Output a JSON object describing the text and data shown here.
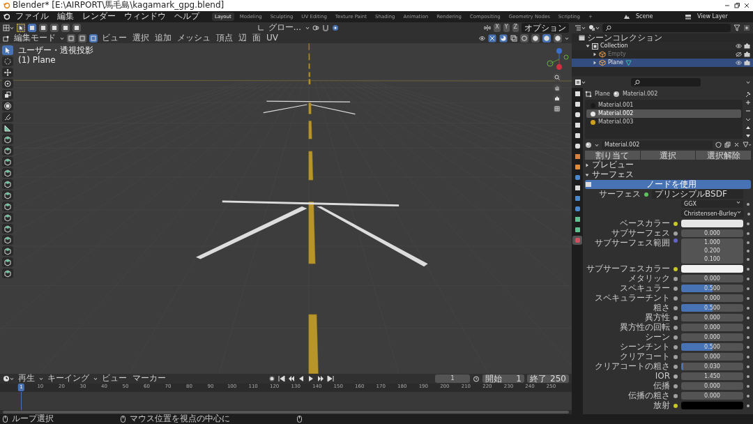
{
  "window": {
    "title": "Blender* [E:\\AIRPORT\\馬毛島\\kagamark_gpg.blend]"
  },
  "menu": [
    "ファイル",
    "編集",
    "レンダー",
    "ウィンドウ",
    "ヘルプ"
  ],
  "workspaces": [
    {
      "label": "Layout",
      "selected": true
    },
    {
      "label": "Modeling",
      "selected": false
    },
    {
      "label": "Sculpting",
      "selected": false
    },
    {
      "label": "UV Editing",
      "selected": false
    },
    {
      "label": "Texture Paint",
      "selected": false
    },
    {
      "label": "Shading",
      "selected": false
    },
    {
      "label": "Animation",
      "selected": false
    },
    {
      "label": "Rendering",
      "selected": false
    },
    {
      "label": "Compositing",
      "selected": false
    },
    {
      "label": "Geometry Nodes",
      "selected": false
    },
    {
      "label": "Scripting",
      "selected": false
    }
  ],
  "add_workspace": "+",
  "scene": {
    "scene": "Scene",
    "view_layer": "View Layer"
  },
  "viewport": {
    "tool_header": {
      "select_modes": [
        {
          "selected": true
        },
        {
          "selected": false
        },
        {
          "selected": false
        },
        {
          "selected": false
        },
        {
          "selected": false
        }
      ],
      "orientation": "グロー...",
      "axes": [
        "X",
        "Y",
        "Z"
      ],
      "options": "オプション"
    },
    "header": {
      "mode": "編集モード",
      "mesh_select": [
        {
          "selected": false
        },
        {
          "selected": false
        },
        {
          "selected": true
        }
      ],
      "menus": [
        "ビュー",
        "選択",
        "追加",
        "メッシュ",
        "頂点",
        "辺",
        "面",
        "UV"
      ],
      "shading": [
        {
          "selected": false
        },
        {
          "selected": false
        },
        {
          "selected": true
        },
        {
          "selected": false
        }
      ]
    },
    "overlay_text": [
      "ユーザー・透視投影",
      "(1) Plane"
    ],
    "tools": [
      {
        "kind": "select",
        "selected": true
      },
      {
        "kind": "cursor",
        "selected": false
      },
      {
        "kind": "move",
        "selected": false
      },
      {
        "kind": "rotate",
        "selected": false
      },
      {
        "kind": "scale",
        "selected": false
      },
      {
        "kind": "transform",
        "selected": false
      },
      {
        "kind": "annotate",
        "selected": false
      },
      {
        "kind": "measure",
        "selected": false
      },
      {
        "kind": "mesh",
        "selected": false
      },
      {
        "kind": "mesh",
        "selected": false
      },
      {
        "kind": "mesh",
        "selected": false
      },
      {
        "kind": "mesh",
        "selected": false
      },
      {
        "kind": "mesh",
        "selected": false
      },
      {
        "kind": "mesh",
        "selected": false
      },
      {
        "kind": "mesh",
        "selected": false
      },
      {
        "kind": "mesh",
        "selected": false
      },
      {
        "kind": "mesh",
        "selected": false
      },
      {
        "kind": "mesh",
        "selected": false
      },
      {
        "kind": "mesh",
        "selected": false
      },
      {
        "kind": "mesh",
        "selected": false
      },
      {
        "kind": "mesh",
        "selected": false
      }
    ]
  },
  "outliner": {
    "root": "シーンコレクション",
    "items": [
      {
        "label": "Collection",
        "expanded": true,
        "selected": false,
        "visible": true,
        "children": [
          {
            "label": "Empty",
            "expanded": false,
            "selected": false,
            "visible": false
          },
          {
            "label": "Plane",
            "expanded": false,
            "selected": true,
            "visible": true
          }
        ]
      }
    ]
  },
  "properties": {
    "tabs": [
      {
        "selected": false
      },
      {
        "selected": false
      },
      {
        "selected": false
      },
      {
        "selected": false
      },
      {
        "selected": false
      },
      {
        "selected": false
      },
      {
        "selected": false
      },
      {
        "selected": false
      },
      {
        "selected": false
      },
      {
        "selected": false
      },
      {
        "selected": false
      },
      {
        "selected": false
      },
      {
        "selected": false
      },
      {
        "selected": false
      },
      {
        "selected": true
      }
    ],
    "breadcrumb": {
      "object": "Plane",
      "material": "Material.002"
    },
    "slots": [
      {
        "name": "Material.001",
        "selected": false,
        "color": "#1a1a1a"
      },
      {
        "name": "Material.002",
        "selected": true,
        "color": "#e6e6e6"
      },
      {
        "name": "Material.003",
        "selected": false,
        "color": "#d0a020"
      }
    ],
    "material_name": "Material.002",
    "slot_buttons": [
      "割り当て",
      "選択",
      "選択解除"
    ],
    "panels": [
      {
        "label": "プレビュー",
        "expanded": false
      },
      {
        "label": "サーフェス",
        "expanded": true
      }
    ],
    "use_nodes": "ノードを使用",
    "rows": [
      {
        "kind": "shader",
        "label": "サーフェス",
        "value": "プリンシプルBSDF"
      },
      {
        "kind": "dropdown",
        "value": "GGX"
      },
      {
        "kind": "dropdown",
        "value": "Christensen-Burley"
      },
      {
        "kind": "color",
        "label": "ベースカラー",
        "color": "#e6e6e6"
      },
      {
        "kind": "value",
        "label": "サブサーフェス",
        "value": "0.000",
        "level": 0
      },
      {
        "kind": "vector",
        "label": "サブサーフェス範囲",
        "values": [
          "1.000",
          "0.200",
          "0.100"
        ]
      },
      {
        "kind": "color",
        "label": "サブサーフェスカラー",
        "color": "#f2f2f2"
      },
      {
        "kind": "value",
        "label": "メタリック",
        "value": "0.000",
        "level": 0
      },
      {
        "kind": "value",
        "label": "スペキュラー",
        "value": "0.500",
        "level": 0.5
      },
      {
        "kind": "value",
        "label": "スペキュラーチント",
        "value": "0.000",
        "level": 0
      },
      {
        "kind": "value",
        "label": "粗さ",
        "value": "0.500",
        "level": 0.5
      },
      {
        "kind": "value",
        "label": "異方性",
        "value": "0.000",
        "level": 0
      },
      {
        "kind": "value",
        "label": "異方性の回転",
        "value": "0.000",
        "level": 0
      },
      {
        "kind": "value",
        "label": "シーン",
        "value": "0.000",
        "level": 0
      },
      {
        "kind": "value",
        "label": "シーンチント",
        "value": "0.500",
        "level": 0.5
      },
      {
        "kind": "value",
        "label": "クリアコート",
        "value": "0.000",
        "level": 0
      },
      {
        "kind": "value",
        "label": "クリアコートの粗さ",
        "value": "0.030",
        "level": 0.03
      },
      {
        "kind": "number",
        "label": "IOR",
        "value": "1.450"
      },
      {
        "kind": "value",
        "label": "伝播",
        "value": "0.000",
        "level": 0
      },
      {
        "kind": "value",
        "label": "伝播の粗さ",
        "value": "0.000",
        "level": 0
      },
      {
        "kind": "color",
        "label": "放射",
        "color": "#000000"
      }
    ]
  },
  "timeline": {
    "menus": [
      "再生",
      "キーイング",
      "ビュー",
      "マーカー"
    ],
    "current_frame": "1",
    "start_label": "開始",
    "start": "1",
    "end_label": "終了",
    "end": "250",
    "playhead": "1",
    "ticks": [
      "10",
      "20",
      "30",
      "40",
      "50",
      "60",
      "70",
      "80",
      "90",
      "100",
      "110",
      "120",
      "130",
      "140",
      "150",
      "160",
      "170",
      "180",
      "190",
      "200",
      "210",
      "220",
      "230",
      "240",
      "250"
    ]
  },
  "status_bar": [
    "ループ選択",
    "マウス位置を視点の中心に"
  ]
}
